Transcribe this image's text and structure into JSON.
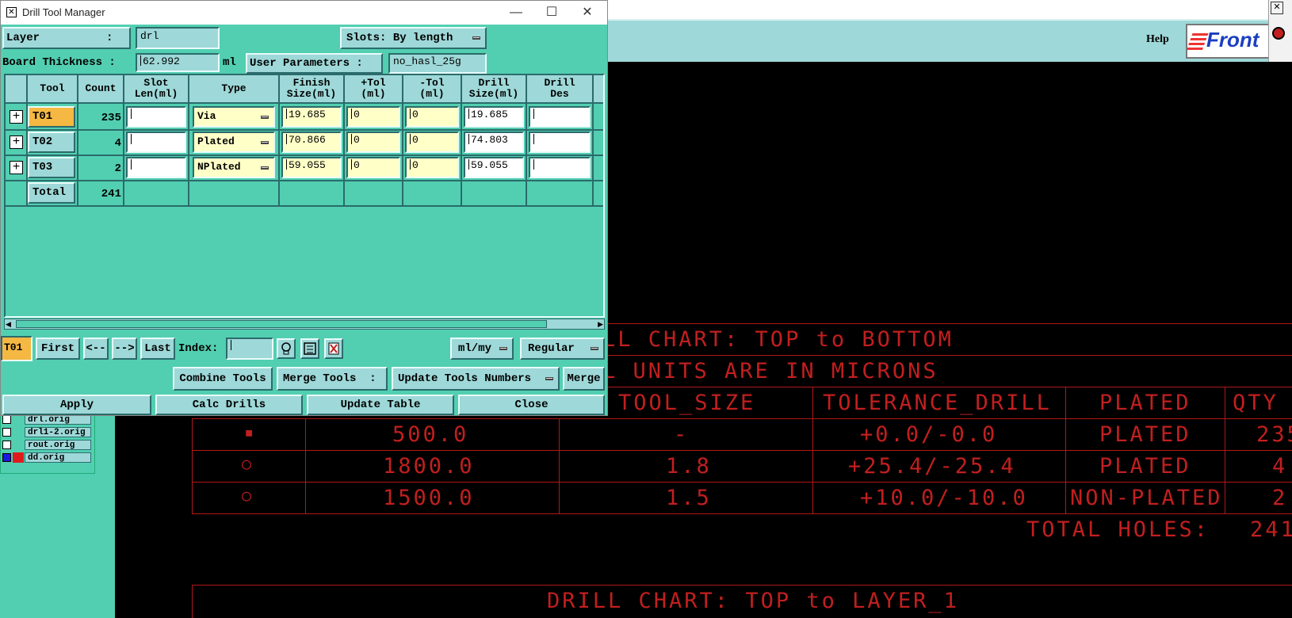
{
  "dialog": {
    "title": "Drill Tool Manager",
    "window_controls": {
      "minimize": "—",
      "maximize": "☐",
      "close": "✕"
    },
    "layer_label": "Layer          :",
    "layer_value": "drl",
    "slots_label": "Slots:",
    "slots_value": "By length",
    "board_thickness_label": "Board Thickness :",
    "board_thickness_value": "62.992",
    "board_thickness_unit": "ml",
    "user_params_label": "User Parameters :",
    "user_params_value": "no_hasl_25g"
  },
  "table": {
    "headers": [
      "Tool",
      "Count",
      "Slot\nLen(ml)",
      "Type",
      "Finish\nSize(ml)",
      "+Tol\n(ml)",
      "-Tol\n(ml)",
      "Drill\nSize(ml)",
      "Drill\nDes"
    ],
    "rows": [
      {
        "tool": "T01",
        "count": "235",
        "slot_len": "",
        "type": "Via",
        "finish": "19.685",
        "ptol": "0",
        "ntol": "0",
        "drill": "19.685",
        "des": ""
      },
      {
        "tool": "T02",
        "count": "4",
        "slot_len": "",
        "type": "Plated",
        "finish": "70.866",
        "ptol": "0",
        "ntol": "0",
        "drill": "74.803",
        "des": ""
      },
      {
        "tool": "T03",
        "count": "2",
        "slot_len": "",
        "type": "NPlated",
        "finish": "59.055",
        "ptol": "0",
        "ntol": "0",
        "drill": "59.055",
        "des": ""
      }
    ],
    "total_label": "Total",
    "total_count": "241"
  },
  "nav": {
    "current": "T01",
    "first": "First",
    "prev": "<--",
    "next": "-->",
    "last": "Last",
    "index_label": "Index:",
    "index_value": "",
    "units": "ml/my",
    "mode": "Regular"
  },
  "actions": {
    "combine": "Combine Tools",
    "merge_tools_label": "Merge Tools  :",
    "merge_tools_value": "Update Tools Numbers",
    "merge": "Merge",
    "apply": "Apply",
    "calc": "Calc Drills",
    "update_table": "Update Table",
    "close": "Close"
  },
  "background": {
    "help": "Help",
    "logo": "Front",
    "layers": [
      "drl.orig",
      "drl1-2.orig",
      "rout.orig",
      "dd.orig"
    ],
    "chart": {
      "title1": "LL CHART: TOP to BOTTOM",
      "units": "L UNITS ARE IN MICRONS",
      "headers": [
        "TOOL_SIZE",
        "TOLERANCE_DRILL",
        "PLATED",
        "QTY"
      ],
      "rows": [
        [
          "500.0",
          "-",
          "+0.0/-0.0",
          "PLATED",
          "235"
        ],
        [
          "1800.0",
          "1.8",
          "+25.4/-25.4",
          "PLATED",
          "4"
        ],
        [
          "1500.0",
          "1.5",
          "+10.0/-10.0",
          "NON-PLATED",
          "2"
        ]
      ],
      "total": "TOTAL HOLES:",
      "total_value": "241",
      "title2": "DRILL CHART: TOP to LAYER_1"
    }
  },
  "colors": {
    "teal": "#52cfb1",
    "light_teal": "#9ed8d8",
    "orange": "#f5b842",
    "chart_red": "#c21f1f"
  }
}
